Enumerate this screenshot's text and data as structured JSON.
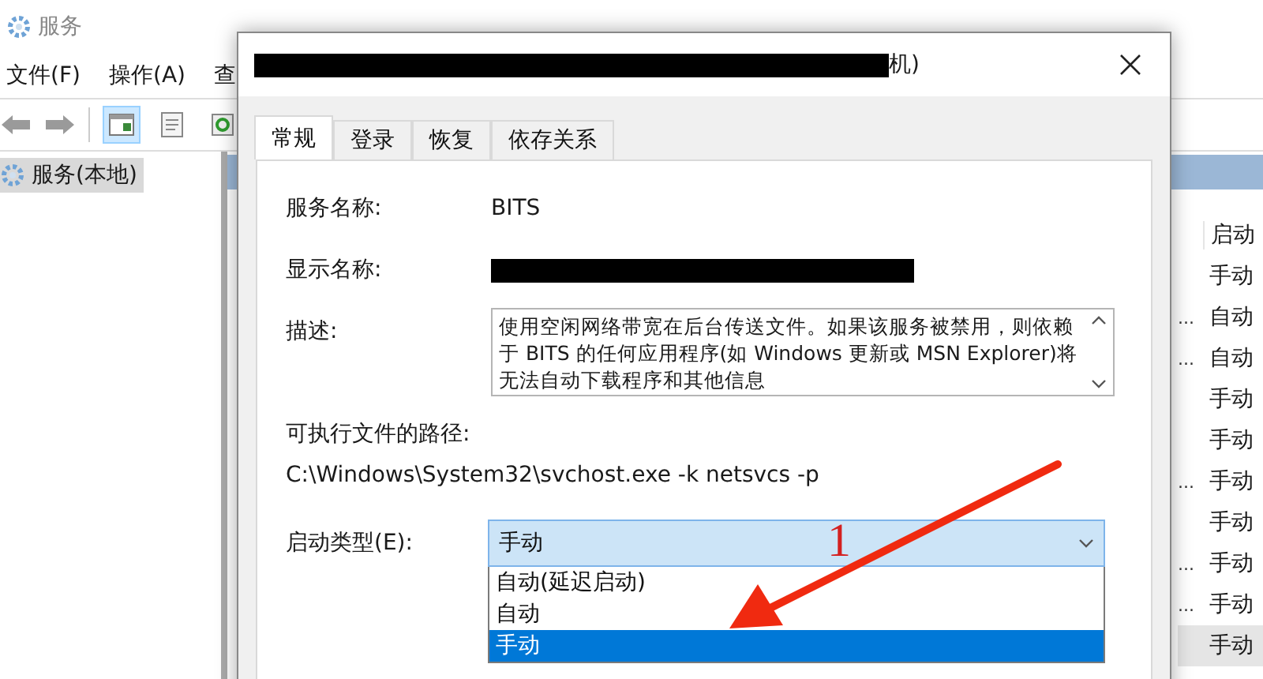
{
  "window": {
    "title": "服务"
  },
  "menu": [
    "文件(F)",
    "操作(A)",
    "查"
  ],
  "tree": [
    {
      "label": "服务(本地)",
      "selected": true
    }
  ],
  "services": {
    "header": "启动",
    "rows": [
      {
        "startup": "手动",
        "selected": false
      },
      {
        "column_1": "...",
        "startup": "自动",
        "selected": false
      },
      {
        "column_1": "...",
        "startup": "自动",
        "selected": false
      },
      {
        "startup": "手动",
        "selected": false
      },
      {
        "startup": "手动",
        "selected": false
      },
      {
        "column_1": "...",
        "startup": "手动",
        "selected": false
      },
      {
        "startup": "手动",
        "selected": false
      },
      {
        "column_1": "...",
        "startup": "手动",
        "selected": false
      },
      {
        "column_1": "...",
        "startup": "手动",
        "selected": false
      },
      {
        "startup": "手动",
        "selected": true
      }
    ]
  },
  "dialog": {
    "title": "机)",
    "title_redacted": true,
    "tabs": [
      {
        "label": "常规",
        "selected": true
      },
      {
        "label": "登录",
        "selected": false
      },
      {
        "label": "恢复",
        "selected": false
      },
      {
        "label": "依存关系",
        "selected": false
      }
    ],
    "service_name": {
      "label": "服务名称:",
      "value": "BITS"
    },
    "display_name": {
      "label": "显示名称:",
      "redacted": true
    },
    "description": {
      "label": "描述:",
      "text": "使用空闲网络带宽在后台传送文件。如果该服务被禁用，则依赖于 BITS 的任何应用程序(如 Windows 更新或 MSN Explorer)将无法自动下载程序和其他信息"
    },
    "path": {
      "label": "可执行文件的路径:",
      "value": "C:\\Windows\\System32\\svchost.exe -k netsvcs -p"
    },
    "startup_type": {
      "label": "启动类型(E):",
      "value": "手动",
      "options": [
        {
          "label": "自动(延迟启动)",
          "selected": false
        },
        {
          "label": "自动",
          "selected": false
        },
        {
          "label": "手动",
          "selected": true
        }
      ]
    }
  },
  "annotation": {
    "label": "1"
  }
}
